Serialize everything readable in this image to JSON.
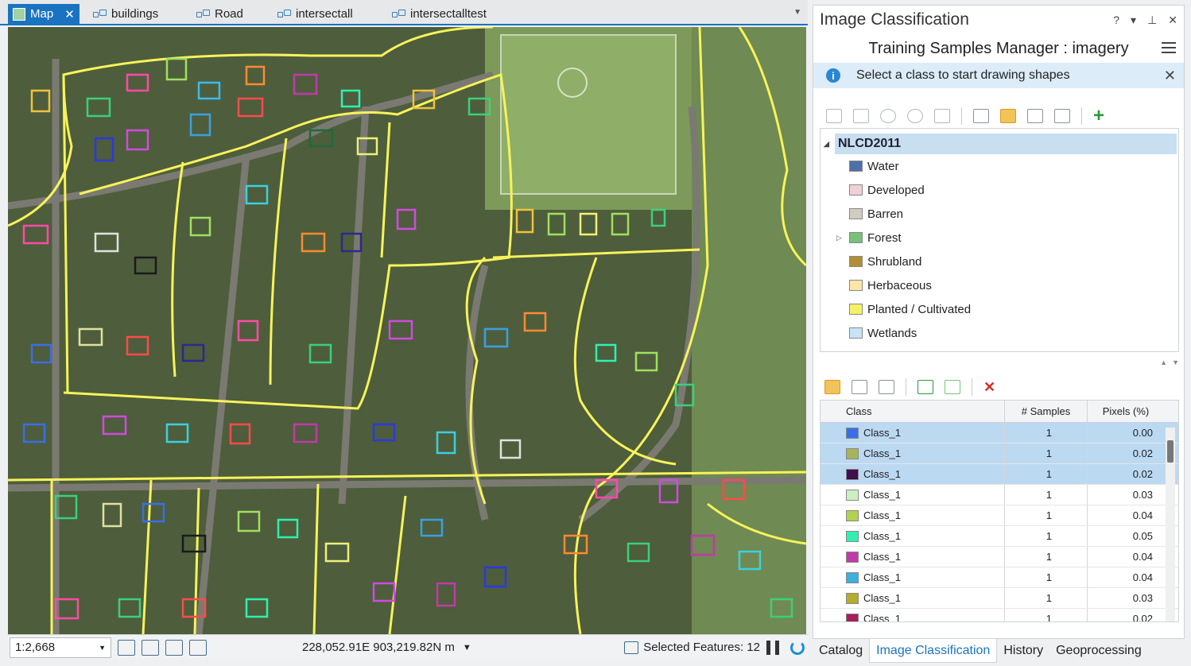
{
  "tabs": [
    {
      "label": "Map",
      "active": true
    },
    {
      "label": "buildings"
    },
    {
      "label": "Road"
    },
    {
      "label": "intersectall"
    },
    {
      "label": "intersectalltest"
    }
  ],
  "status": {
    "scale": "1:2,668",
    "coordinates": "228,052.91E 903,219.82N m",
    "selected_features": "Selected Features: 12"
  },
  "panel": {
    "title": "Image Classification",
    "manager_title": "Training Samples Manager : imagery",
    "info": "Select a class to start drawing shapes",
    "schema": {
      "root": "NLCD2011",
      "classes": [
        {
          "name": "Water",
          "color": "#4f6fa8"
        },
        {
          "name": "Developed",
          "color": "#f0d0d2"
        },
        {
          "name": "Barren",
          "color": "#d2ccc0"
        },
        {
          "name": "Forest",
          "color": "#77c17a",
          "expandable": true
        },
        {
          "name": "Shrubland",
          "color": "#b18f36"
        },
        {
          "name": "Herbaceous",
          "color": "#fde6a8"
        },
        {
          "name": "Planted / Cultivated",
          "color": "#f6f066"
        },
        {
          "name": "Wetlands",
          "color": "#c7e4f7"
        }
      ]
    },
    "grid": {
      "headers": [
        "Class",
        "# Samples",
        "Pixels (%)"
      ],
      "rows": [
        {
          "class": "Class_1",
          "samples": "1",
          "pixels": "0.00",
          "color": "#3a6ee8",
          "selected": true
        },
        {
          "class": "Class_1",
          "samples": "1",
          "pixels": "0.02",
          "color": "#a6b45a",
          "selected": true
        },
        {
          "class": "Class_1",
          "samples": "1",
          "pixels": "0.02",
          "color": "#3e0f4a",
          "selected": true
        },
        {
          "class": "Class_1",
          "samples": "1",
          "pixels": "0.03",
          "color": "#ccf0c2"
        },
        {
          "class": "Class_1",
          "samples": "1",
          "pixels": "0.04",
          "color": "#b2d14e"
        },
        {
          "class": "Class_1",
          "samples": "1",
          "pixels": "0.05",
          "color": "#2ef0b0"
        },
        {
          "class": "Class_1",
          "samples": "1",
          "pixels": "0.04",
          "color": "#c03aaa"
        },
        {
          "class": "Class_1",
          "samples": "1",
          "pixels": "0.04",
          "color": "#3ab0dc"
        },
        {
          "class": "Class_1",
          "samples": "1",
          "pixels": "0.03",
          "color": "#b4ac2a"
        },
        {
          "class": "Class_1",
          "samples": "1",
          "pixels": "0.02",
          "color": "#a81e58"
        }
      ]
    }
  },
  "bottom_tabs": [
    {
      "label": "Catalog"
    },
    {
      "label": "Image Classification",
      "active": true
    },
    {
      "label": "History"
    },
    {
      "label": "Geoprocessing"
    }
  ]
}
